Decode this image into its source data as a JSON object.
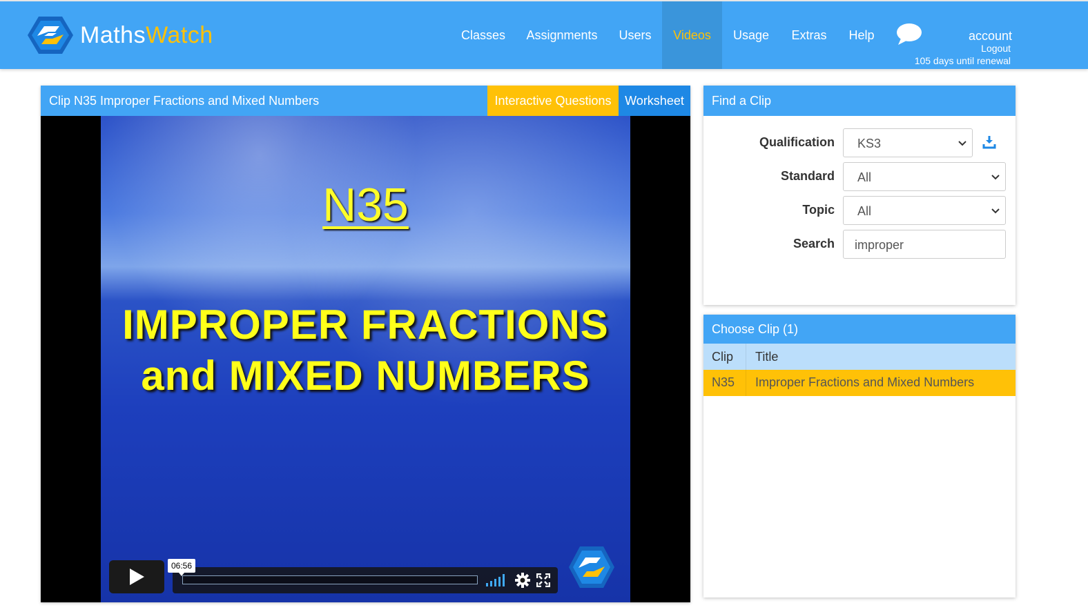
{
  "brand": {
    "name_part1": "Maths",
    "name_part2": "Watch",
    "primary_color": "#42a5f5",
    "accent_color": "#ffc107"
  },
  "nav": {
    "items": [
      {
        "label": "Classes"
      },
      {
        "label": "Assignments"
      },
      {
        "label": "Users"
      },
      {
        "label": "Videos",
        "active": true
      },
      {
        "label": "Usage"
      },
      {
        "label": "Extras"
      },
      {
        "label": "Help"
      }
    ],
    "chat_icon": "speech-bubble-icon",
    "account": "account",
    "logout": "Logout",
    "renewal": "105 days until renewal"
  },
  "video": {
    "title": "Clip N35 Improper Fractions and Mixed Numbers",
    "interactive_label": "Interactive Questions",
    "worksheet_label": "Worksheet",
    "frame_code": "N35",
    "frame_line1": "IMPROPER FRACTIONS",
    "frame_line2": "and MIXED NUMBERS",
    "time": "06:56",
    "progress": 0
  },
  "find": {
    "heading": "Find a Clip",
    "qualification_label": "Qualification",
    "qualification_value": "KS3",
    "standard_label": "Standard",
    "standard_value": "All",
    "topic_label": "Topic",
    "topic_value": "All",
    "search_label": "Search",
    "search_value": "improper"
  },
  "choose": {
    "heading": "Choose Clip (1)",
    "columns": [
      "Clip",
      "Title"
    ],
    "rows": [
      {
        "clip": "N35",
        "title": "Improper Fractions and Mixed Numbers"
      }
    ]
  }
}
